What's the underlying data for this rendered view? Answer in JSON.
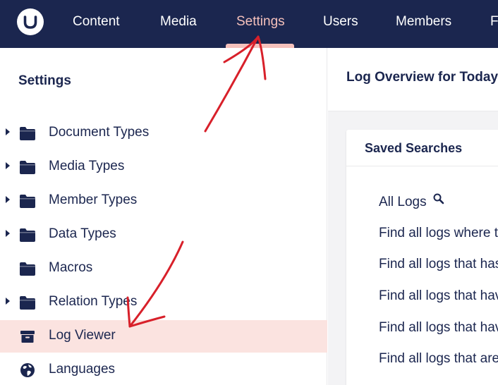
{
  "nav": {
    "items": [
      {
        "label": "Content"
      },
      {
        "label": "Media"
      },
      {
        "label": "Settings",
        "active": true
      },
      {
        "label": "Users"
      },
      {
        "label": "Members"
      },
      {
        "label": "F"
      }
    ]
  },
  "sidebar": {
    "title": "Settings",
    "items": [
      {
        "label": "Document Types",
        "icon": "folder-icon",
        "expandable": true
      },
      {
        "label": "Media Types",
        "icon": "folder-icon",
        "expandable": true
      },
      {
        "label": "Member Types",
        "icon": "folder-icon",
        "expandable": true
      },
      {
        "label": "Data Types",
        "icon": "folder-icon",
        "expandable": true
      },
      {
        "label": "Macros",
        "icon": "folder-icon",
        "expandable": false
      },
      {
        "label": "Relation Types",
        "icon": "folder-icon",
        "expandable": true
      },
      {
        "label": "Log Viewer",
        "icon": "archive-box-icon",
        "expandable": false,
        "selected": true
      },
      {
        "label": "Languages",
        "icon": "globe-icon",
        "expandable": false
      }
    ]
  },
  "main": {
    "title": "Log Overview for Today",
    "panel": {
      "title": "Saved Searches",
      "searches": [
        {
          "label": "All Logs"
        },
        {
          "label": "Find all logs where t"
        },
        {
          "label": "Find all logs that has"
        },
        {
          "label": "Find all logs that hav"
        },
        {
          "label": "Find all logs that hav"
        },
        {
          "label": "Find all logs that are"
        }
      ]
    }
  },
  "colors": {
    "header_bg": "#1b264f",
    "active_nav": "#f5c1bc",
    "selected_row": "#fbe3e0",
    "annotation_red": "#d8202a"
  }
}
